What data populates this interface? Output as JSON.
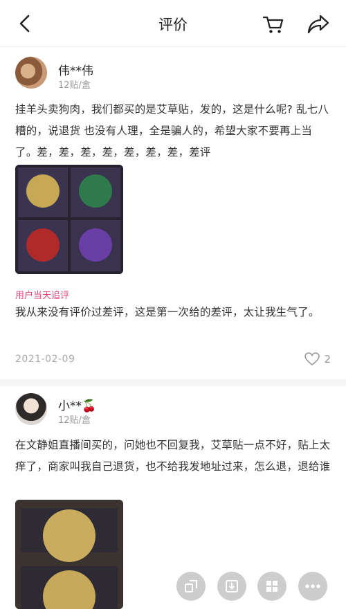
{
  "header": {
    "title": "评价",
    "back_icon": "chevron-left-icon",
    "cart_icon": "cart-icon",
    "share_icon": "share-icon"
  },
  "reviews": [
    {
      "username": "伟**伟",
      "spec": "12贴/盒",
      "content": "挂羊头卖狗肉，我们都买的是艾草贴，发的，这是什么呢? 乱七八糟的，说退货 也没有人理，全是骗人的，希望大家不要再上当了。差，差，差，差，差，差，差，差评",
      "followup_label": "用户当天追评",
      "followup": "我从来没有评价过差评，这是第一次给的差评，太让我生气了。",
      "date": "2021-02-09",
      "likes": "2"
    },
    {
      "username": "小**🍒",
      "spec": "12贴/盒",
      "content": "在文静姐直播间买的，问她也不回复我，艾草贴一点不好，贴上太痒了，商家叫我自己退货，也不给我发地址过来，怎么退，退给谁"
    }
  ],
  "fabs": [
    "switch-icon",
    "download-icon",
    "grid-icon",
    "more-icon"
  ],
  "colors": {
    "accent": "#e0457b",
    "muted": "#999999"
  }
}
